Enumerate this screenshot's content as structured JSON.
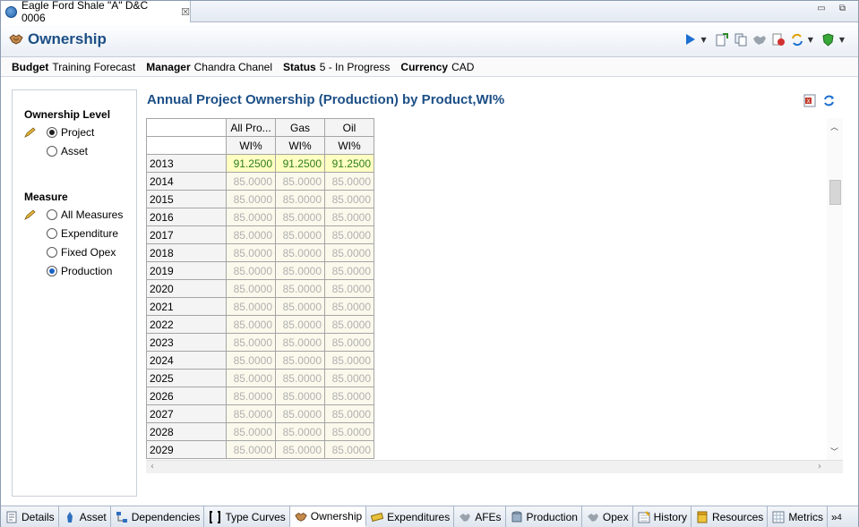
{
  "window": {
    "tab_title": "Eagle Ford Shale \"A\" D&C 0006",
    "close_glyph": "☒",
    "controls": "▭ ⧉"
  },
  "header": {
    "title": "Ownership",
    "icon": "handshake-icon",
    "toolbar_icons": [
      "run-icon",
      "export-icon",
      "copy-icon",
      "approve-icon",
      "reject-icon",
      "sync-icon",
      "security-icon"
    ]
  },
  "info": {
    "budget_label": "Budget",
    "budget_value": "Training Forecast",
    "manager_label": "Manager",
    "manager_value": "Chandra Chanel",
    "status_label": "Status",
    "status_value": "5 - In Progress",
    "currency_label": "Currency",
    "currency_value": "CAD"
  },
  "left": {
    "level_title": "Ownership Level",
    "level_options": [
      "Project",
      "Asset"
    ],
    "level_selected": "Project",
    "measure_title": "Measure",
    "measure_options": [
      "All Measures",
      "Expenditure",
      "Fixed Opex",
      "Production"
    ],
    "measure_selected": "Production"
  },
  "report": {
    "title": "Annual Project Ownership (Production) by Product,WI%",
    "icons": [
      "excel-export-icon",
      "refresh-icon"
    ],
    "columns": [
      "All Pro...",
      "Gas",
      "Oil"
    ],
    "subheader": [
      "WI%",
      "WI%",
      "WI%"
    ],
    "rows": [
      {
        "year": "2013",
        "values": [
          "91.2500",
          "91.2500",
          "91.2500"
        ],
        "highlight": true
      },
      {
        "year": "2014",
        "values": [
          "85.0000",
          "85.0000",
          "85.0000"
        ]
      },
      {
        "year": "2015",
        "values": [
          "85.0000",
          "85.0000",
          "85.0000"
        ]
      },
      {
        "year": "2016",
        "values": [
          "85.0000",
          "85.0000",
          "85.0000"
        ]
      },
      {
        "year": "2017",
        "values": [
          "85.0000",
          "85.0000",
          "85.0000"
        ]
      },
      {
        "year": "2018",
        "values": [
          "85.0000",
          "85.0000",
          "85.0000"
        ]
      },
      {
        "year": "2019",
        "values": [
          "85.0000",
          "85.0000",
          "85.0000"
        ]
      },
      {
        "year": "2020",
        "values": [
          "85.0000",
          "85.0000",
          "85.0000"
        ]
      },
      {
        "year": "2021",
        "values": [
          "85.0000",
          "85.0000",
          "85.0000"
        ]
      },
      {
        "year": "2022",
        "values": [
          "85.0000",
          "85.0000",
          "85.0000"
        ]
      },
      {
        "year": "2023",
        "values": [
          "85.0000",
          "85.0000",
          "85.0000"
        ]
      },
      {
        "year": "2024",
        "values": [
          "85.0000",
          "85.0000",
          "85.0000"
        ]
      },
      {
        "year": "2025",
        "values": [
          "85.0000",
          "85.0000",
          "85.0000"
        ]
      },
      {
        "year": "2026",
        "values": [
          "85.0000",
          "85.0000",
          "85.0000"
        ]
      },
      {
        "year": "2027",
        "values": [
          "85.0000",
          "85.0000",
          "85.0000"
        ]
      },
      {
        "year": "2028",
        "values": [
          "85.0000",
          "85.0000",
          "85.0000"
        ]
      },
      {
        "year": "2029",
        "values": [
          "85.0000",
          "85.0000",
          "85.0000"
        ]
      }
    ],
    "highlight_color": "#ffffc2",
    "highlight_text_color": "#2d7d1a"
  },
  "tabs": [
    {
      "label": "Details",
      "icon": "details-icon"
    },
    {
      "label": "Asset",
      "icon": "asset-icon"
    },
    {
      "label": "Dependencies",
      "icon": "dependencies-icon"
    },
    {
      "label": "Type Curves",
      "icon": "type-curves-icon"
    },
    {
      "label": "Ownership",
      "icon": "ownership-icon",
      "active": true
    },
    {
      "label": "Expenditures",
      "icon": "expenditures-icon"
    },
    {
      "label": "AFEs",
      "icon": "afes-icon"
    },
    {
      "label": "Production",
      "icon": "production-icon"
    },
    {
      "label": "Opex",
      "icon": "opex-icon"
    },
    {
      "label": "History",
      "icon": "history-icon"
    },
    {
      "label": "Resources",
      "icon": "resources-icon"
    },
    {
      "label": "Metrics",
      "icon": "metrics-icon"
    }
  ],
  "more_tabs": "»",
  "more_count": "4",
  "accent_color": "#1c4f86"
}
